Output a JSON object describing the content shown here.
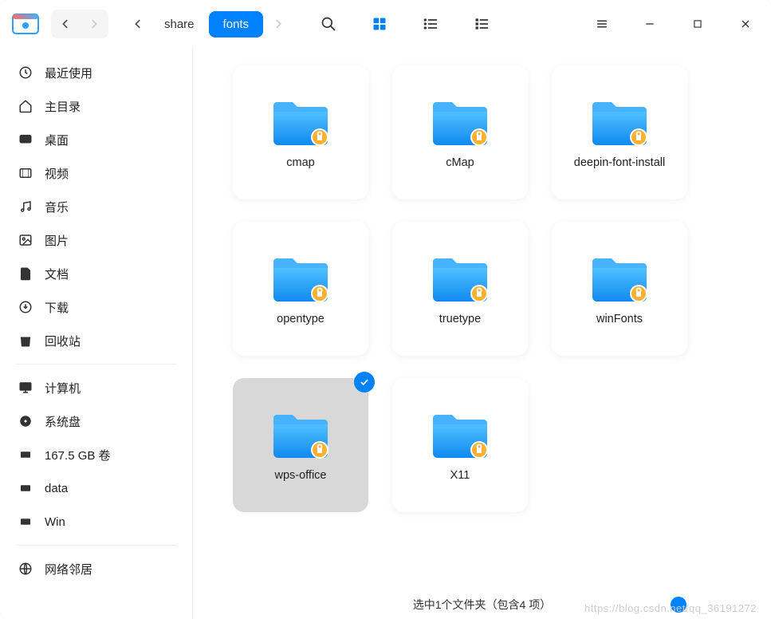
{
  "breadcrumb": {
    "parent": "share",
    "current": "fonts"
  },
  "sidebar": {
    "section1": [
      {
        "id": "recent",
        "label": "最近使用"
      },
      {
        "id": "home",
        "label": "主目录"
      },
      {
        "id": "desktop",
        "label": "桌面"
      },
      {
        "id": "videos",
        "label": "视频"
      },
      {
        "id": "music",
        "label": "音乐"
      },
      {
        "id": "pictures",
        "label": "图片"
      },
      {
        "id": "documents",
        "label": "文档"
      },
      {
        "id": "downloads",
        "label": "下载"
      },
      {
        "id": "trash",
        "label": "回收站"
      }
    ],
    "section2": [
      {
        "id": "computer",
        "label": "计算机"
      },
      {
        "id": "sysdisk",
        "label": "系统盘"
      },
      {
        "id": "vol",
        "label": "167.5 GB 卷"
      },
      {
        "id": "data",
        "label": "data"
      },
      {
        "id": "win",
        "label": "Win"
      }
    ],
    "section3": [
      {
        "id": "network",
        "label": "网络邻居"
      }
    ]
  },
  "folders": [
    {
      "name": "cmap",
      "locked": true,
      "selected": false
    },
    {
      "name": "cMap",
      "locked": true,
      "selected": false
    },
    {
      "name": "deepin-font-install",
      "locked": true,
      "selected": false
    },
    {
      "name": "opentype",
      "locked": true,
      "selected": false
    },
    {
      "name": "truetype",
      "locked": true,
      "selected": false
    },
    {
      "name": "winFonts",
      "locked": true,
      "selected": false
    },
    {
      "name": "wps-office",
      "locked": true,
      "selected": true
    },
    {
      "name": "X11",
      "locked": true,
      "selected": false
    }
  ],
  "status": "选中1个文件夹（包含4 项）",
  "watermark": "https://blog.csdn.net/qq_36191272"
}
